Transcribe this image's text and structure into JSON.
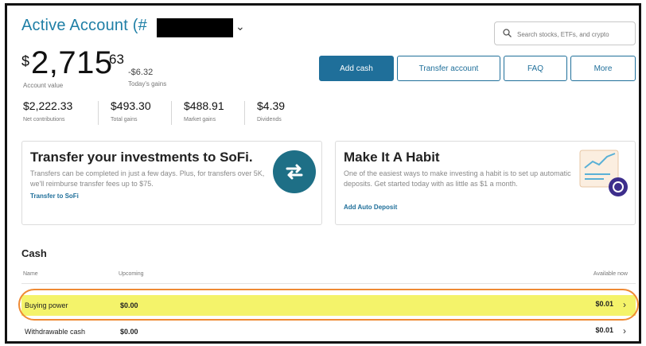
{
  "header": {
    "title": "Active Account (#",
    "search_placeholder": "Search stocks, ETFs, and crypto"
  },
  "summary": {
    "dollar_sign": "$",
    "amount_whole": "2,715",
    "amount_cents": "63",
    "account_value_label": "Account value",
    "todays_gains_value": "-$6.32",
    "todays_gains_label": "Today's gains"
  },
  "actions": {
    "add_cash": "Add cash",
    "transfer_account": "Transfer account",
    "faq": "FAQ",
    "more": "More"
  },
  "stats": [
    {
      "value": "$2,222.33",
      "label": "Net contributions"
    },
    {
      "value": "$493.30",
      "label": "Total gains"
    },
    {
      "value": "$488.91",
      "label": "Market gains"
    },
    {
      "value": "$4.39",
      "label": "Dividends"
    }
  ],
  "cards": {
    "transfer": {
      "title": "Transfer your investments to SoFi.",
      "body": "Transfers can be completed in just a few days. Plus, for transfers over 5K, we'll reimburse transfer fees up to $75.",
      "link": "Transfer to SoFi"
    },
    "habit": {
      "title": "Make It A Habit",
      "body": "One of the easiest ways to make investing a habit is to set up automatic deposits. Get started today with as little as $1 a month.",
      "link": "Add Auto Deposit"
    }
  },
  "cash": {
    "title": "Cash",
    "columns": [
      "Name",
      "Upcoming",
      "Available now"
    ],
    "rows": [
      {
        "name": "Buying power",
        "upcoming": "$0.00",
        "available": "$0.01"
      },
      {
        "name": "Withdrawable cash",
        "upcoming": "$0.00",
        "available": "$0.01"
      }
    ]
  },
  "colors": {
    "accent": "#1f6f9a",
    "highlight": "#f4f36a",
    "ring": "#ef8a34",
    "swap_icon_bg": "#1e6f86"
  },
  "icons": [
    "search-icon",
    "chevron-down-icon",
    "swap-arrows-icon",
    "chart-document-icon",
    "chevron-right-icon"
  ]
}
